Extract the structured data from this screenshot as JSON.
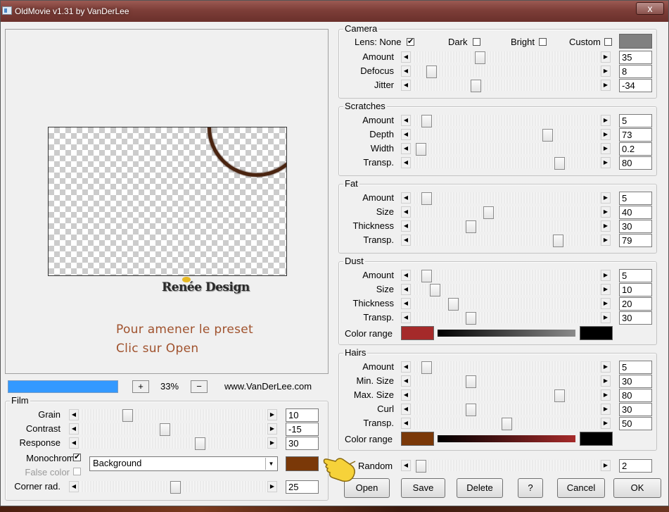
{
  "window": {
    "title": "OldMovie v1.31 by VanDerLee",
    "close_label": "x"
  },
  "preview": {
    "logo_text": "Renée Design",
    "instruction_line1": "Pour amener le preset",
    "instruction_line2": "Clic sur Open"
  },
  "zoom": {
    "plus": "+",
    "minus": "−",
    "value": "33%",
    "site": "www.VanDerLee.com",
    "progress": 1.0
  },
  "camera": {
    "title": "Camera",
    "lens_label": "Lens: None",
    "lens_checked": "✔",
    "dark_label": "Dark",
    "bright_label": "Bright",
    "custom_label": "Custom",
    "custom_color": "#808080",
    "sliders": [
      {
        "label": "Amount",
        "value": "35",
        "pos": 0.35
      },
      {
        "label": "Defocus",
        "value": "8",
        "pos": 0.08
      },
      {
        "label": "Jitter",
        "value": "-34",
        "pos": 0.33
      }
    ]
  },
  "scratches": {
    "title": "Scratches",
    "sliders": [
      {
        "label": "Amount",
        "value": "5",
        "pos": 0.05
      },
      {
        "label": "Depth",
        "value": "73",
        "pos": 0.73
      },
      {
        "label": "Width",
        "value": "0.2",
        "pos": 0.02
      },
      {
        "label": "Transp.",
        "value": "80",
        "pos": 0.8
      }
    ]
  },
  "fat": {
    "title": "Fat",
    "sliders": [
      {
        "label": "Amount",
        "value": "5",
        "pos": 0.05
      },
      {
        "label": "Size",
        "value": "40",
        "pos": 0.4
      },
      {
        "label": "Thickness",
        "value": "30",
        "pos": 0.3
      },
      {
        "label": "Transp.",
        "value": "79",
        "pos": 0.79
      }
    ]
  },
  "dust": {
    "title": "Dust",
    "sliders": [
      {
        "label": "Amount",
        "value": "5",
        "pos": 0.05
      },
      {
        "label": "Size",
        "value": "10",
        "pos": 0.1
      },
      {
        "label": "Thickness",
        "value": "20",
        "pos": 0.2
      },
      {
        "label": "Transp.",
        "value": "30",
        "pos": 0.3
      }
    ],
    "color_range_label": "Color range",
    "color_start": "#a52a2a",
    "color_end": "#000000"
  },
  "hairs": {
    "title": "Hairs",
    "sliders": [
      {
        "label": "Amount",
        "value": "5",
        "pos": 0.05
      },
      {
        "label": "Min. Size",
        "value": "30",
        "pos": 0.3
      },
      {
        "label": "Max. Size",
        "value": "80",
        "pos": 0.8
      },
      {
        "label": "Curl",
        "value": "30",
        "pos": 0.3
      },
      {
        "label": "Transp.",
        "value": "50",
        "pos": 0.5
      }
    ],
    "color_range_label": "Color range",
    "color_start": "#7a3808",
    "color_end": "#000000"
  },
  "random": {
    "label": "Random",
    "value": "2",
    "pos": 0.02
  },
  "film": {
    "title": "Film",
    "sliders": [
      {
        "label": "Grain",
        "value": "10",
        "pos": 0.24
      },
      {
        "label": "Contrast",
        "value": "-15",
        "pos": 0.45
      },
      {
        "label": "Response",
        "value": "30",
        "pos": 0.65
      }
    ],
    "monochrome_label": "Monochrome",
    "monochrome_checked": "✔",
    "false_color_label": "False color",
    "mode_value": "Background",
    "mono_color": "#7a3808",
    "corner_label": "Corner rad.",
    "corner_value": "25",
    "corner_pos": 0.51
  },
  "buttons": {
    "open": "Open",
    "save": "Save",
    "delete": "Delete",
    "help": "?",
    "cancel": "Cancel",
    "ok": "OK"
  }
}
